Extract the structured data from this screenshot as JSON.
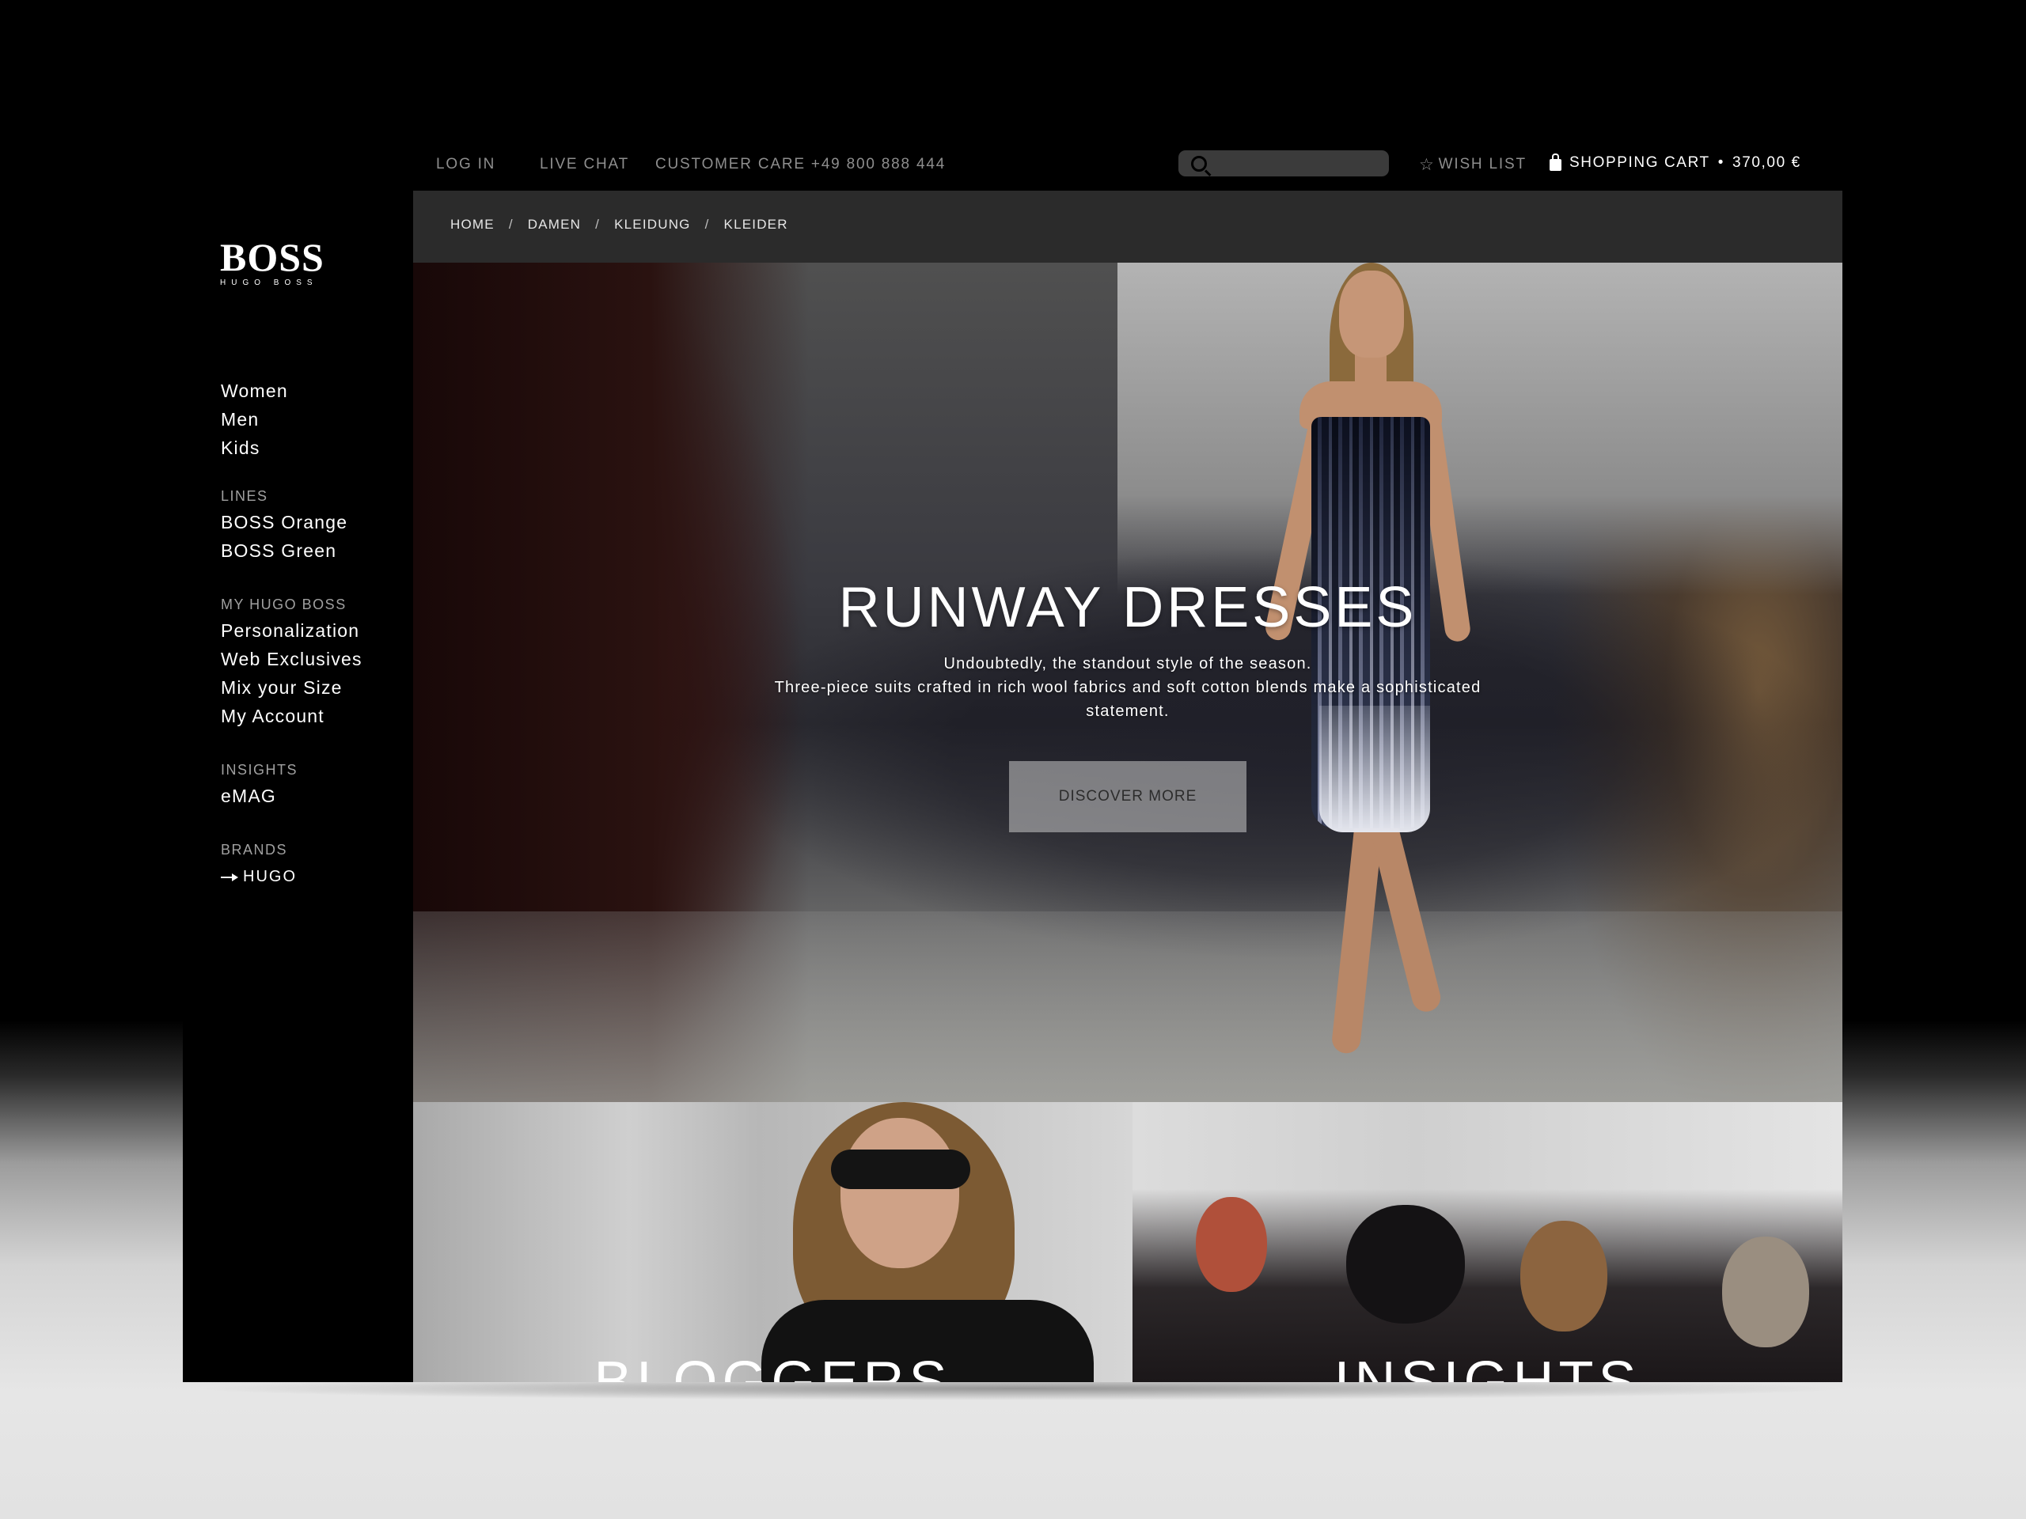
{
  "logo": {
    "main": "BOSS",
    "sub": "HUGO BOSS"
  },
  "sidebar": {
    "main_items": [
      {
        "label": "Women"
      },
      {
        "label": "Men"
      },
      {
        "label": "Kids"
      }
    ],
    "sections": [
      {
        "heading": "LINES",
        "items": [
          {
            "label": "BOSS Orange"
          },
          {
            "label": "BOSS Green"
          }
        ]
      },
      {
        "heading": "MY HUGO BOSS",
        "items": [
          {
            "label": "Personalization"
          },
          {
            "label": "Web Exclusives"
          },
          {
            "label": "Mix your Size"
          },
          {
            "label": "My Account"
          }
        ]
      },
      {
        "heading": "INSIGHTS",
        "items": [
          {
            "label": "eMAG"
          }
        ]
      },
      {
        "heading": "BRANDS",
        "items": [
          {
            "label": "HUGO"
          }
        ]
      }
    ]
  },
  "topbar": {
    "login": "LOG IN",
    "live_chat": "LIVE CHAT",
    "customer_care": "CUSTOMER CARE +49 800 888 444",
    "search_placeholder": "",
    "wish_list": "WISH LIST",
    "cart_label": "SHOPPING CART",
    "cart_separator": "•",
    "cart_total": "370,00 €"
  },
  "icons": {
    "search": "search-icon",
    "wish": "star-icon",
    "cart": "shopping-bag-icon",
    "brand_arrow": "arrow-right-icon"
  },
  "breadcrumb": [
    "HOME",
    "DAMEN",
    "KLEIDUNG",
    "KLEIDER"
  ],
  "breadcrumb_separator": "/",
  "hero": {
    "title": "RUNWAY DRESSES",
    "subtitle_line1": "Undoubtedly, the standout style of the season.",
    "subtitle_line2": "Three-piece suits crafted in rich wool fabrics and soft cotton blends make a sophisticated statement.",
    "button": "DISCOVER MORE"
  },
  "tiles": [
    {
      "title": "BLOGGERS"
    },
    {
      "title": "INSIGHTS"
    }
  ]
}
